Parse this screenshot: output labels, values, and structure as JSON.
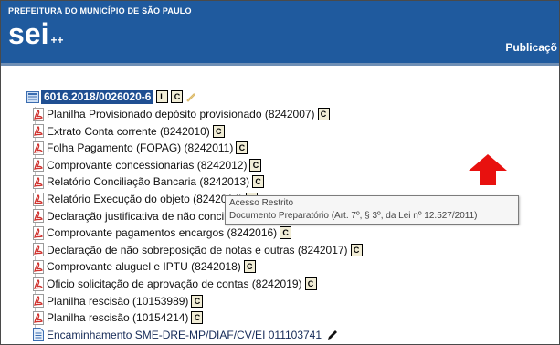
{
  "header": {
    "org_name": "PREFEITURA DO MUNICÍPIO DE SÃO PAULO",
    "logo_text": "sei",
    "logo_suffix": "++",
    "menu_label": "Publicaçõ"
  },
  "process": {
    "number": "6016.2018/0026020-6",
    "button_l": "L",
    "button_c": "C"
  },
  "documents": [
    {
      "label": "Planilha Provisionado depósito provisionado (8242007)",
      "button": "C",
      "type": "pdf"
    },
    {
      "label": "Extrato Conta corrente (8242010)",
      "button": "C",
      "type": "pdf"
    },
    {
      "label": "Folha Pagamento (FOPAG) (8242011)",
      "button": "C",
      "type": "pdf"
    },
    {
      "label": "Comprovante concessionarias (8242012)",
      "button": "C",
      "type": "pdf"
    },
    {
      "label": "Relatório Conciliação Bancaria (8242013)",
      "button": "C",
      "type": "pdf"
    },
    {
      "label": "Relatório Execução do objeto (8242014)",
      "button": "C",
      "type": "pdf"
    },
    {
      "label": "Declaração justificativa de não conciliação (8242015)",
      "button": "C",
      "type": "pdf"
    },
    {
      "label": "Comprovante pagamentos encargos (8242016)",
      "button": "C",
      "type": "pdf"
    },
    {
      "label": "Declaração de não sobreposição de notas e outras (8242017)",
      "button": "C",
      "type": "pdf"
    },
    {
      "label": "Comprovante aluguel e IPTU (8242018)",
      "button": "C",
      "type": "pdf"
    },
    {
      "label": "Oficio solicitação de aprovação de contas (8242019)",
      "button": "C",
      "type": "pdf"
    },
    {
      "label": "Planilha rescisão (10153989)",
      "button": "C",
      "type": "pdf"
    },
    {
      "label": "Planilha rescisão (10154214)",
      "button": "C",
      "type": "pdf"
    },
    {
      "label": "Encaminhamento SME-DRE-MP/DIAF/CV/EI 011103741",
      "button": "",
      "type": "doc"
    }
  ],
  "tooltip": {
    "line1": "Acesso Restrito",
    "line2": "Documento Preparatório (Art. 7º, § 3º, da Lei nº 12.527/2011)"
  },
  "colors": {
    "header_bg": "#1f5a9e",
    "selected_bg": "#1f4f92",
    "pdf_red": "#d0312d",
    "arrow_red": "#e8110f"
  },
  "icons": {
    "root": "folder-icon",
    "pdf": "pdf-icon",
    "doc": "document-icon",
    "edit": "pencil-icon",
    "pointer": "red-up-arrow"
  }
}
